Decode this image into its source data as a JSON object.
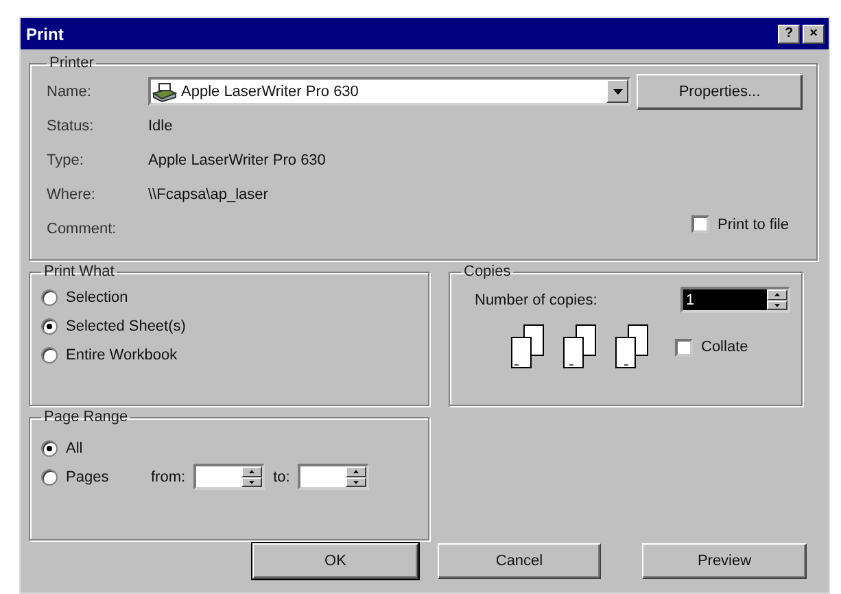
{
  "window": {
    "title": "Print",
    "help_button": "?",
    "close_button": "×"
  },
  "printer": {
    "label": "Printer",
    "name_label": "Name:",
    "name_value": "Apple LaserWriter Pro 630",
    "properties_button": "Properties...",
    "fields": [
      {
        "label": "Status:",
        "value": "Idle"
      },
      {
        "label": "Type:",
        "value": "Apple LaserWriter Pro 630"
      },
      {
        "label": "Where:",
        "value": "\\\\Fcapsa\\ap_laser"
      },
      {
        "label": "Comment:"
      }
    ],
    "print_to_file": {
      "label": "Print to file",
      "checked": false
    }
  },
  "print_what": {
    "label": "Print What",
    "options": [
      {
        "label": "Selection",
        "selected": false
      },
      {
        "label": "Selected Sheet(s)",
        "selected": true
      },
      {
        "label": "Entire Workbook",
        "selected": false
      }
    ]
  },
  "copies": {
    "label": "Copies",
    "number_label": "Number of copies:",
    "number_value": "1",
    "collate": {
      "label": "Collate",
      "checked": false
    }
  },
  "page_range": {
    "label": "Page Range",
    "options": [
      {
        "label": "All",
        "selected": true
      },
      {
        "label": "Pages",
        "selected": false
      }
    ],
    "from_label": "from:",
    "to_label": "to:"
  },
  "buttons": [
    {
      "label": "OK",
      "default": true
    },
    {
      "label": "Cancel",
      "default": false
    },
    {
      "label": "Preview",
      "default": false
    }
  ]
}
